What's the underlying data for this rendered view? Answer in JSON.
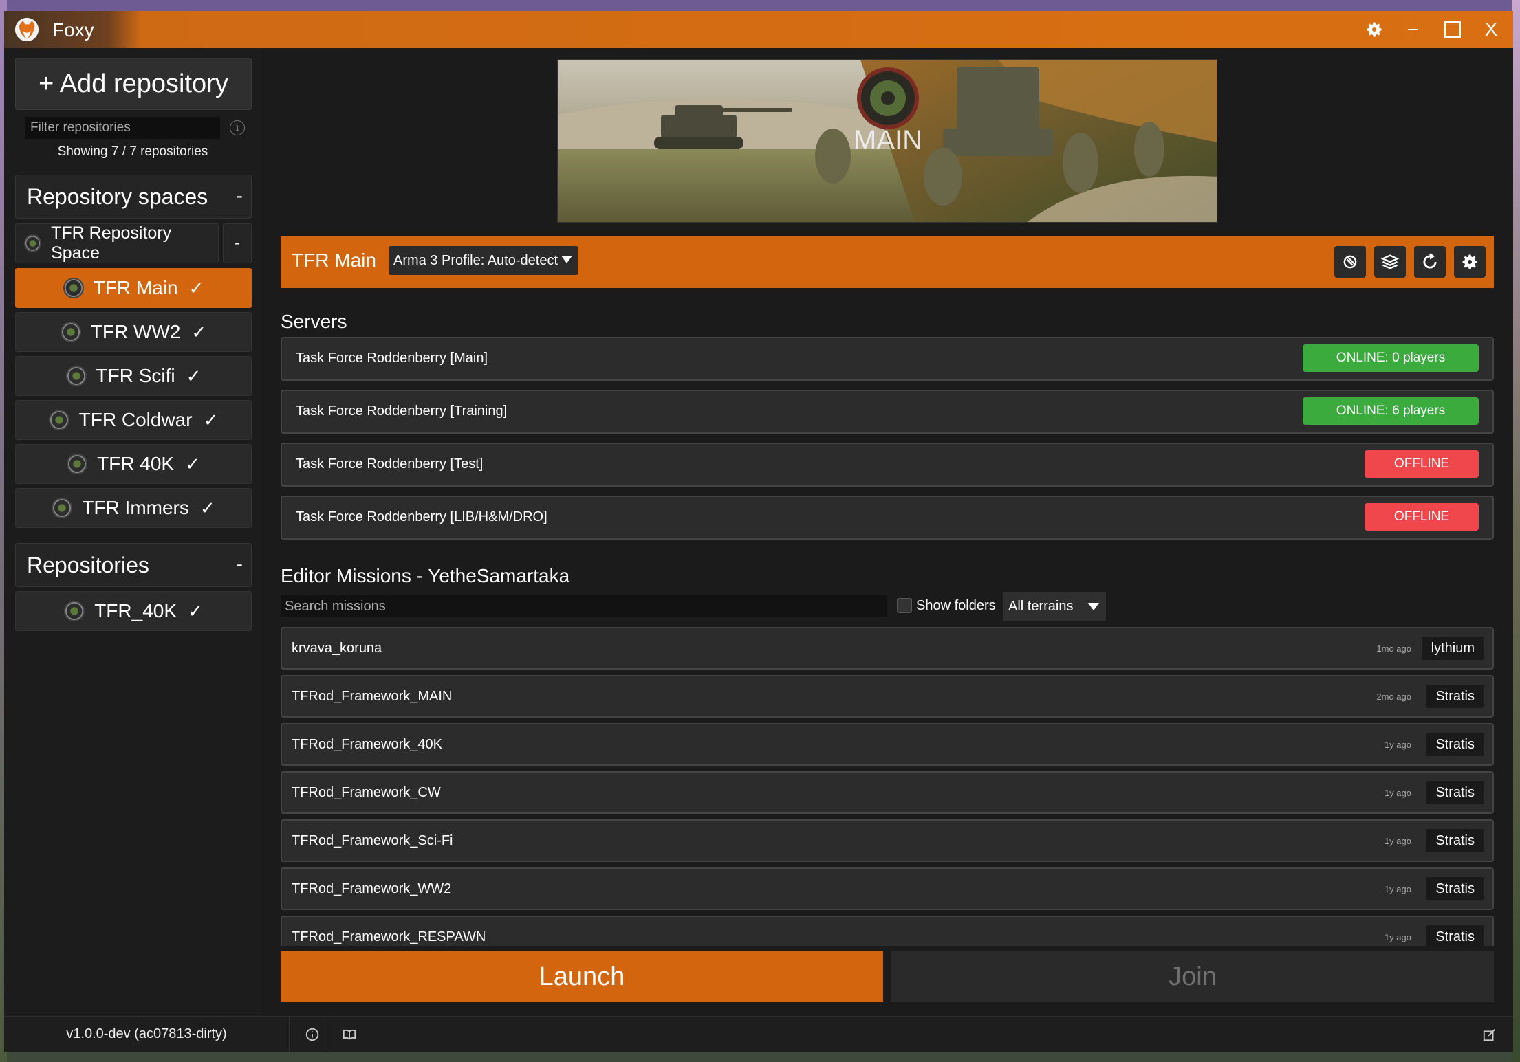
{
  "window": {
    "title": "Foxy"
  },
  "sidebar": {
    "add_repository": "+ Add repository",
    "filter_placeholder": "Filter repositories",
    "showing": "Showing 7 / 7 repositories",
    "spaces_header": "Repository spaces",
    "spaces_collapse": "-",
    "space": {
      "label": "TFR Repository Space",
      "collapse": "-"
    },
    "space_repos": [
      {
        "label": "TFR Main",
        "check": "✓",
        "active": true
      },
      {
        "label": "TFR WW2",
        "check": "✓",
        "active": false
      },
      {
        "label": "TFR Scifi",
        "check": "✓",
        "active": false
      },
      {
        "label": "TFR Coldwar",
        "check": "✓",
        "active": false
      },
      {
        "label": "TFR 40K",
        "check": "✓",
        "active": false
      },
      {
        "label": "TFR Immers",
        "check": "✓",
        "active": false
      }
    ],
    "repositories_header": "Repositories",
    "repositories_collapse": "-",
    "repositories": [
      {
        "label": "TFR_40K",
        "check": "✓"
      }
    ]
  },
  "banner": {
    "text": "MAIN"
  },
  "profile_bar": {
    "name": "TFR Main",
    "profile_select": "Arma 3 Profile: Auto-detect"
  },
  "servers": {
    "header": "Servers",
    "items": [
      {
        "name": "Task Force Roddenberry [Main]",
        "status": "ONLINE: 0 players"
      },
      {
        "name": "Task Force Roddenberry [Training]",
        "status": "ONLINE: 6 players"
      },
      {
        "name": "Task Force Roddenberry [Test]",
        "status": "OFFLINE"
      },
      {
        "name": "Task Force Roddenberry [LIB/H&M/DRO]",
        "status": "OFFLINE"
      }
    ]
  },
  "missions": {
    "header": "Editor Missions - YetheSamartaka",
    "search_placeholder": "Search missions",
    "show_folders": "Show folders",
    "terrain_filter": "All terrains",
    "items": [
      {
        "name": "krvava_koruna",
        "age": "1mo ago",
        "terrain": "lythium"
      },
      {
        "name": "TFRod_Framework_MAIN",
        "age": "2mo ago",
        "terrain": "Stratis"
      },
      {
        "name": "TFRod_Framework_40K",
        "age": "1y ago",
        "terrain": "Stratis"
      },
      {
        "name": "TFRod_Framework_CW",
        "age": "1y ago",
        "terrain": "Stratis"
      },
      {
        "name": "TFRod_Framework_Sci-Fi",
        "age": "1y ago",
        "terrain": "Stratis"
      },
      {
        "name": "TFRod_Framework_WW2",
        "age": "1y ago",
        "terrain": "Stratis"
      },
      {
        "name": "TFRod_Framework_RESPAWN",
        "age": "1y ago",
        "terrain": "Stratis"
      }
    ]
  },
  "actions": {
    "launch": "Launch",
    "join": "Join"
  },
  "footer": {
    "version": "v1.0.0-dev (ac07813-dirty)"
  },
  "colors": {
    "accent": "#d4650f",
    "online": "#3bab3e",
    "offline": "#f0474c",
    "background": "#1b1b1b"
  }
}
